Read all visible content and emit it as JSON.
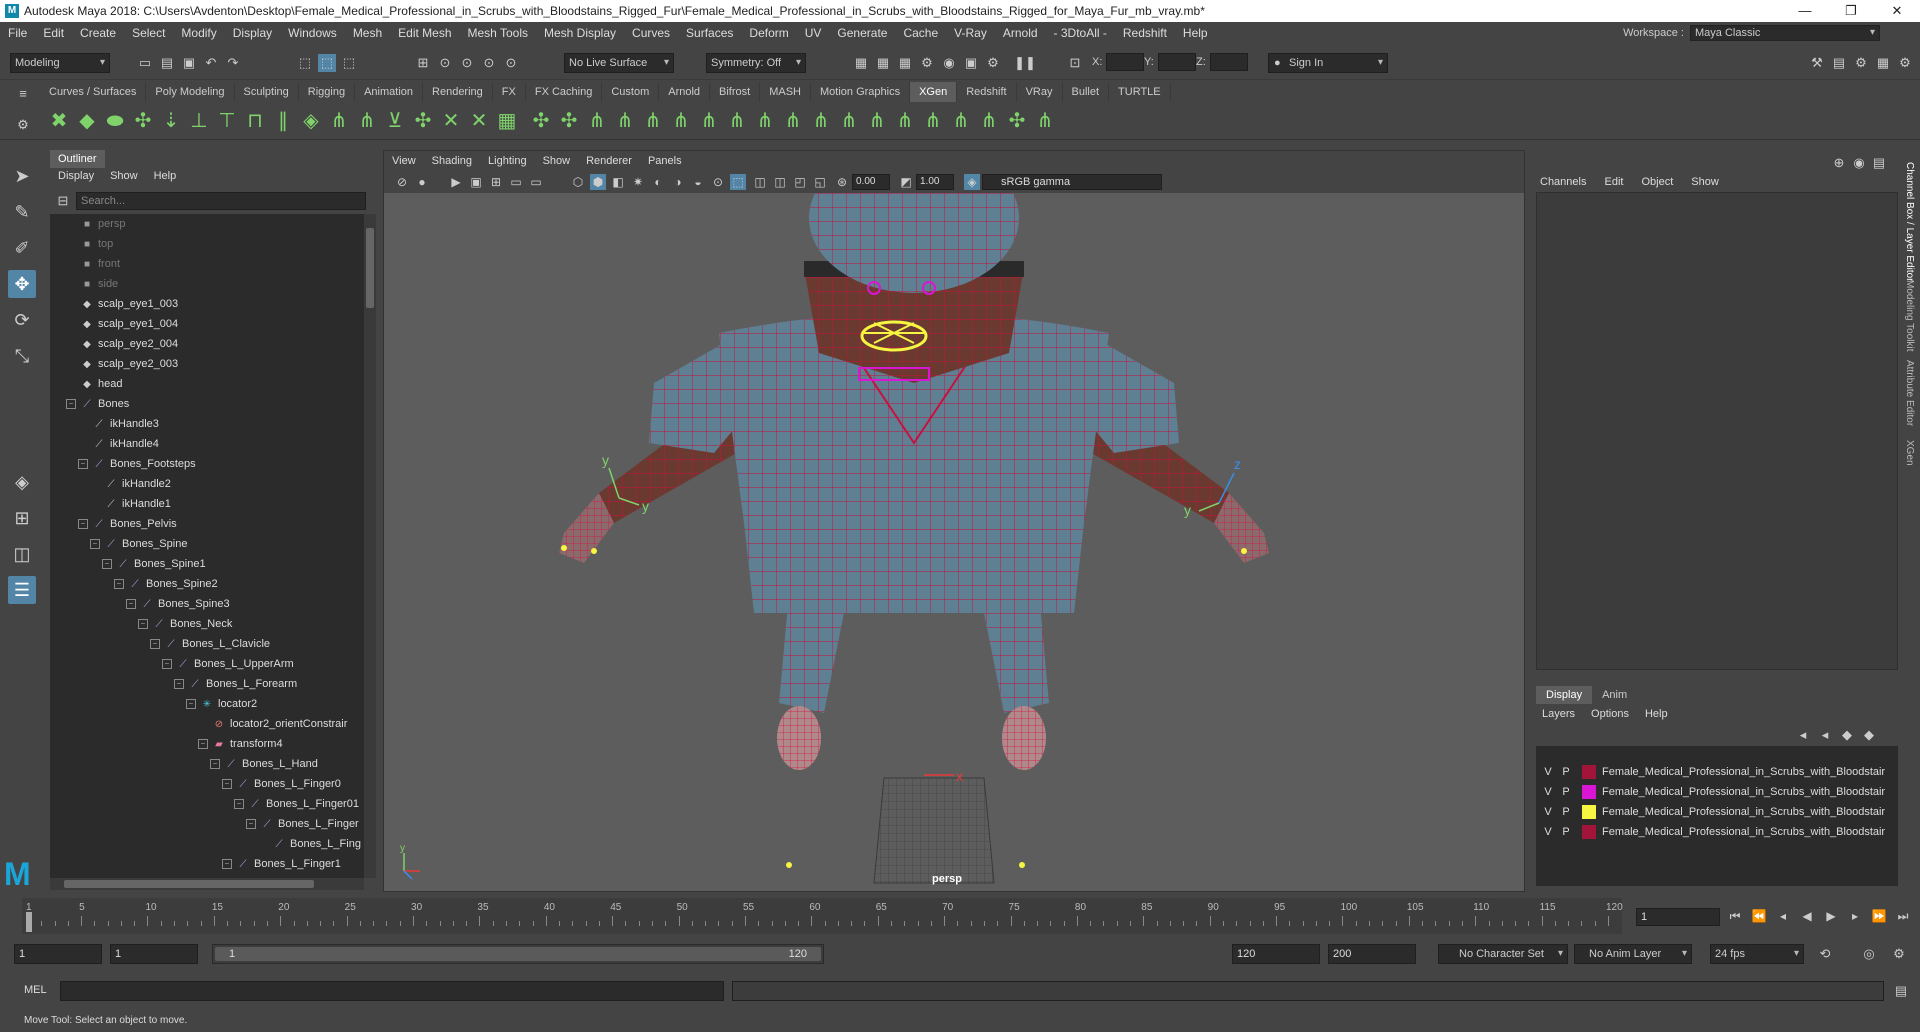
{
  "window": {
    "title": "Autodesk Maya 2018: C:\\Users\\Avdenton\\Desktop\\Female_Medical_Professional_in_Scrubs_with_Bloodstains_Rigged_Fur\\Female_Medical_Professional_in_Scrubs_with_Bloodstains_Rigged_for_Maya_Fur_mb_vray.mb*",
    "minimize": "—",
    "maximize": "❐",
    "close": "✕"
  },
  "menubar": {
    "items": [
      "File",
      "Edit",
      "Create",
      "Select",
      "Modify",
      "Display",
      "Windows",
      "Mesh",
      "Edit Mesh",
      "Mesh Tools",
      "Mesh Display",
      "Curves",
      "Surfaces",
      "Deform",
      "UV",
      "Generate",
      "Cache",
      "V-Ray",
      "Arnold",
      "- 3DtoAll -",
      "Redshift",
      "Help"
    ]
  },
  "workspace": {
    "label": "Workspace :",
    "value": "Maya Classic"
  },
  "statusline": {
    "mode": "Modeling",
    "live_surface": "No Live Surface",
    "symmetry": "Symmetry: Off",
    "x_label": "X:",
    "y_label": "Y:",
    "z_label": "Z:",
    "sign_in": "Sign In"
  },
  "shelf": {
    "tabs": [
      "Curves / Surfaces",
      "Poly Modeling",
      "Sculpting",
      "Rigging",
      "Animation",
      "Rendering",
      "FX",
      "FX Caching",
      "Custom",
      "Arnold",
      "Bifrost",
      "MASH",
      "Motion Graphics",
      "XGen",
      "Redshift",
      "VRay",
      "Bullet",
      "TURTLE"
    ],
    "active_tab": "XGen"
  },
  "outliner": {
    "tab": "Outliner",
    "menu": [
      "Display",
      "Show",
      "Help"
    ],
    "search_placeholder": "Search...",
    "rows": [
      {
        "label": "persp",
        "indent": 0,
        "icon": "camera-icon",
        "dim": true
      },
      {
        "label": "top",
        "indent": 0,
        "icon": "camera-icon",
        "dim": true
      },
      {
        "label": "front",
        "indent": 0,
        "icon": "camera-icon",
        "dim": true
      },
      {
        "label": "side",
        "indent": 0,
        "icon": "camera-icon",
        "dim": true
      },
      {
        "label": "scalp_eye1_003",
        "indent": 0,
        "icon": "mesh-icon"
      },
      {
        "label": "scalp_eye1_004",
        "indent": 0,
        "icon": "mesh-icon"
      },
      {
        "label": "scalp_eye2_004",
        "indent": 0,
        "icon": "mesh-icon"
      },
      {
        "label": "scalp_eye2_003",
        "indent": 0,
        "icon": "mesh-icon"
      },
      {
        "label": "head",
        "indent": 0,
        "icon": "mesh-icon"
      },
      {
        "label": "Bones",
        "indent": 0,
        "icon": "joint-icon",
        "exp": true
      },
      {
        "label": "ikHandle3",
        "indent": 1,
        "icon": "ik-icon"
      },
      {
        "label": "ikHandle4",
        "indent": 1,
        "icon": "ik-icon"
      },
      {
        "label": "Bones_Footsteps",
        "indent": 1,
        "icon": "joint-icon",
        "exp": true
      },
      {
        "label": "ikHandle2",
        "indent": 2,
        "icon": "ik-icon"
      },
      {
        "label": "ikHandle1",
        "indent": 2,
        "icon": "ik-icon"
      },
      {
        "label": "Bones_Pelvis",
        "indent": 1,
        "icon": "joint-icon",
        "exp": true
      },
      {
        "label": "Bones_Spine",
        "indent": 2,
        "icon": "joint-icon",
        "exp": true
      },
      {
        "label": "Bones_Spine1",
        "indent": 3,
        "icon": "joint-icon",
        "exp": true
      },
      {
        "label": "Bones_Spine2",
        "indent": 4,
        "icon": "joint-icon",
        "exp": true
      },
      {
        "label": "Bones_Spine3",
        "indent": 5,
        "icon": "joint-icon",
        "exp": true
      },
      {
        "label": "Bones_Neck",
        "indent": 6,
        "icon": "joint-icon",
        "exp": true
      },
      {
        "label": "Bones_L_Clavicle",
        "indent": 7,
        "icon": "joint-icon",
        "exp": true
      },
      {
        "label": "Bones_L_UpperArm",
        "indent": 8,
        "icon": "joint-icon",
        "exp": true
      },
      {
        "label": "Bones_L_Forearm",
        "indent": 9,
        "icon": "joint-icon",
        "exp": true
      },
      {
        "label": "locator2",
        "indent": 10,
        "icon": "locator-icon",
        "exp": true
      },
      {
        "label": "locator2_orientConstrair",
        "indent": 11,
        "icon": "constraint-icon"
      },
      {
        "label": "transform4",
        "indent": 11,
        "icon": "transform-icon",
        "exp": true
      },
      {
        "label": "Bones_L_Hand",
        "indent": 12,
        "icon": "joint-icon",
        "exp": true
      },
      {
        "label": "Bones_L_Finger0",
        "indent": 13,
        "icon": "joint-icon",
        "exp": true
      },
      {
        "label": "Bones_L_Finger01",
        "indent": 14,
        "icon": "joint-icon",
        "exp": true
      },
      {
        "label": "Bones_L_Finger",
        "indent": 15,
        "icon": "joint-icon",
        "exp": true
      },
      {
        "label": "Bones_L_Fing",
        "indent": 16,
        "icon": "joint-icon"
      },
      {
        "label": "Bones_L_Finger1",
        "indent": 13,
        "icon": "joint-icon",
        "exp": true
      }
    ]
  },
  "viewport": {
    "menu": [
      "View",
      "Shading",
      "Lighting",
      "Show",
      "Renderer",
      "Panels"
    ],
    "exposure": "0.00",
    "gamma": "1.00",
    "colorspace": "sRGB gamma",
    "camera_label": "persp",
    "axis_labels": {
      "y": "y",
      "z": "z",
      "x": "x"
    }
  },
  "channelbox": {
    "menu": [
      "Channels",
      "Edit",
      "Object",
      "Show"
    ]
  },
  "layereditor": {
    "tabs": [
      "Display",
      "Anim"
    ],
    "active_tab": "Display",
    "menu": [
      "Layers",
      "Options",
      "Help"
    ],
    "layers": [
      {
        "v": "V",
        "p": "P",
        "color": "#a3143a",
        "name": "Female_Medical_Professional_in_Scrubs_with_Bloodstair"
      },
      {
        "v": "V",
        "p": "P",
        "color": "#d816d4",
        "name": "Female_Medical_Professional_in_Scrubs_with_Bloodstair"
      },
      {
        "v": "V",
        "p": "P",
        "color": "#f5f542",
        "name": "Female_Medical_Professional_in_Scrubs_with_Bloodstair"
      },
      {
        "v": "V",
        "p": "P",
        "color": "#a3143a",
        "name": "Female_Medical_Professional_in_Scrubs_with_Bloodstair"
      }
    ]
  },
  "vertical_tabs": [
    "Channel Box / Layer Editor",
    "Modeling Toolkit",
    "Attribute Editor",
    "XGen"
  ],
  "timeslider": {
    "ticks": [
      1,
      5,
      10,
      15,
      20,
      25,
      30,
      35,
      40,
      45,
      50,
      55,
      60,
      65,
      70,
      75,
      80,
      85,
      90,
      95,
      100,
      105,
      110,
      115,
      120
    ],
    "start": 1,
    "end": 120,
    "current_frame": "1"
  },
  "rangebar": {
    "start": "1",
    "start2": "1",
    "slider_start": "1",
    "slider_end": "120",
    "end": "120",
    "end2": "200",
    "character_set": "No Character Set",
    "anim_layer": "No Anim Layer",
    "fps": "24 fps"
  },
  "cmdline": {
    "label": "MEL"
  },
  "helpline": {
    "text": "Move Tool: Select an object to move."
  },
  "colors": {
    "wire": "#c8103e",
    "skin": "#6a3a30",
    "scrubs": "#5f7f93",
    "locator": "#f5f542",
    "magenta": "#d816d4",
    "active": "#5285a6"
  }
}
